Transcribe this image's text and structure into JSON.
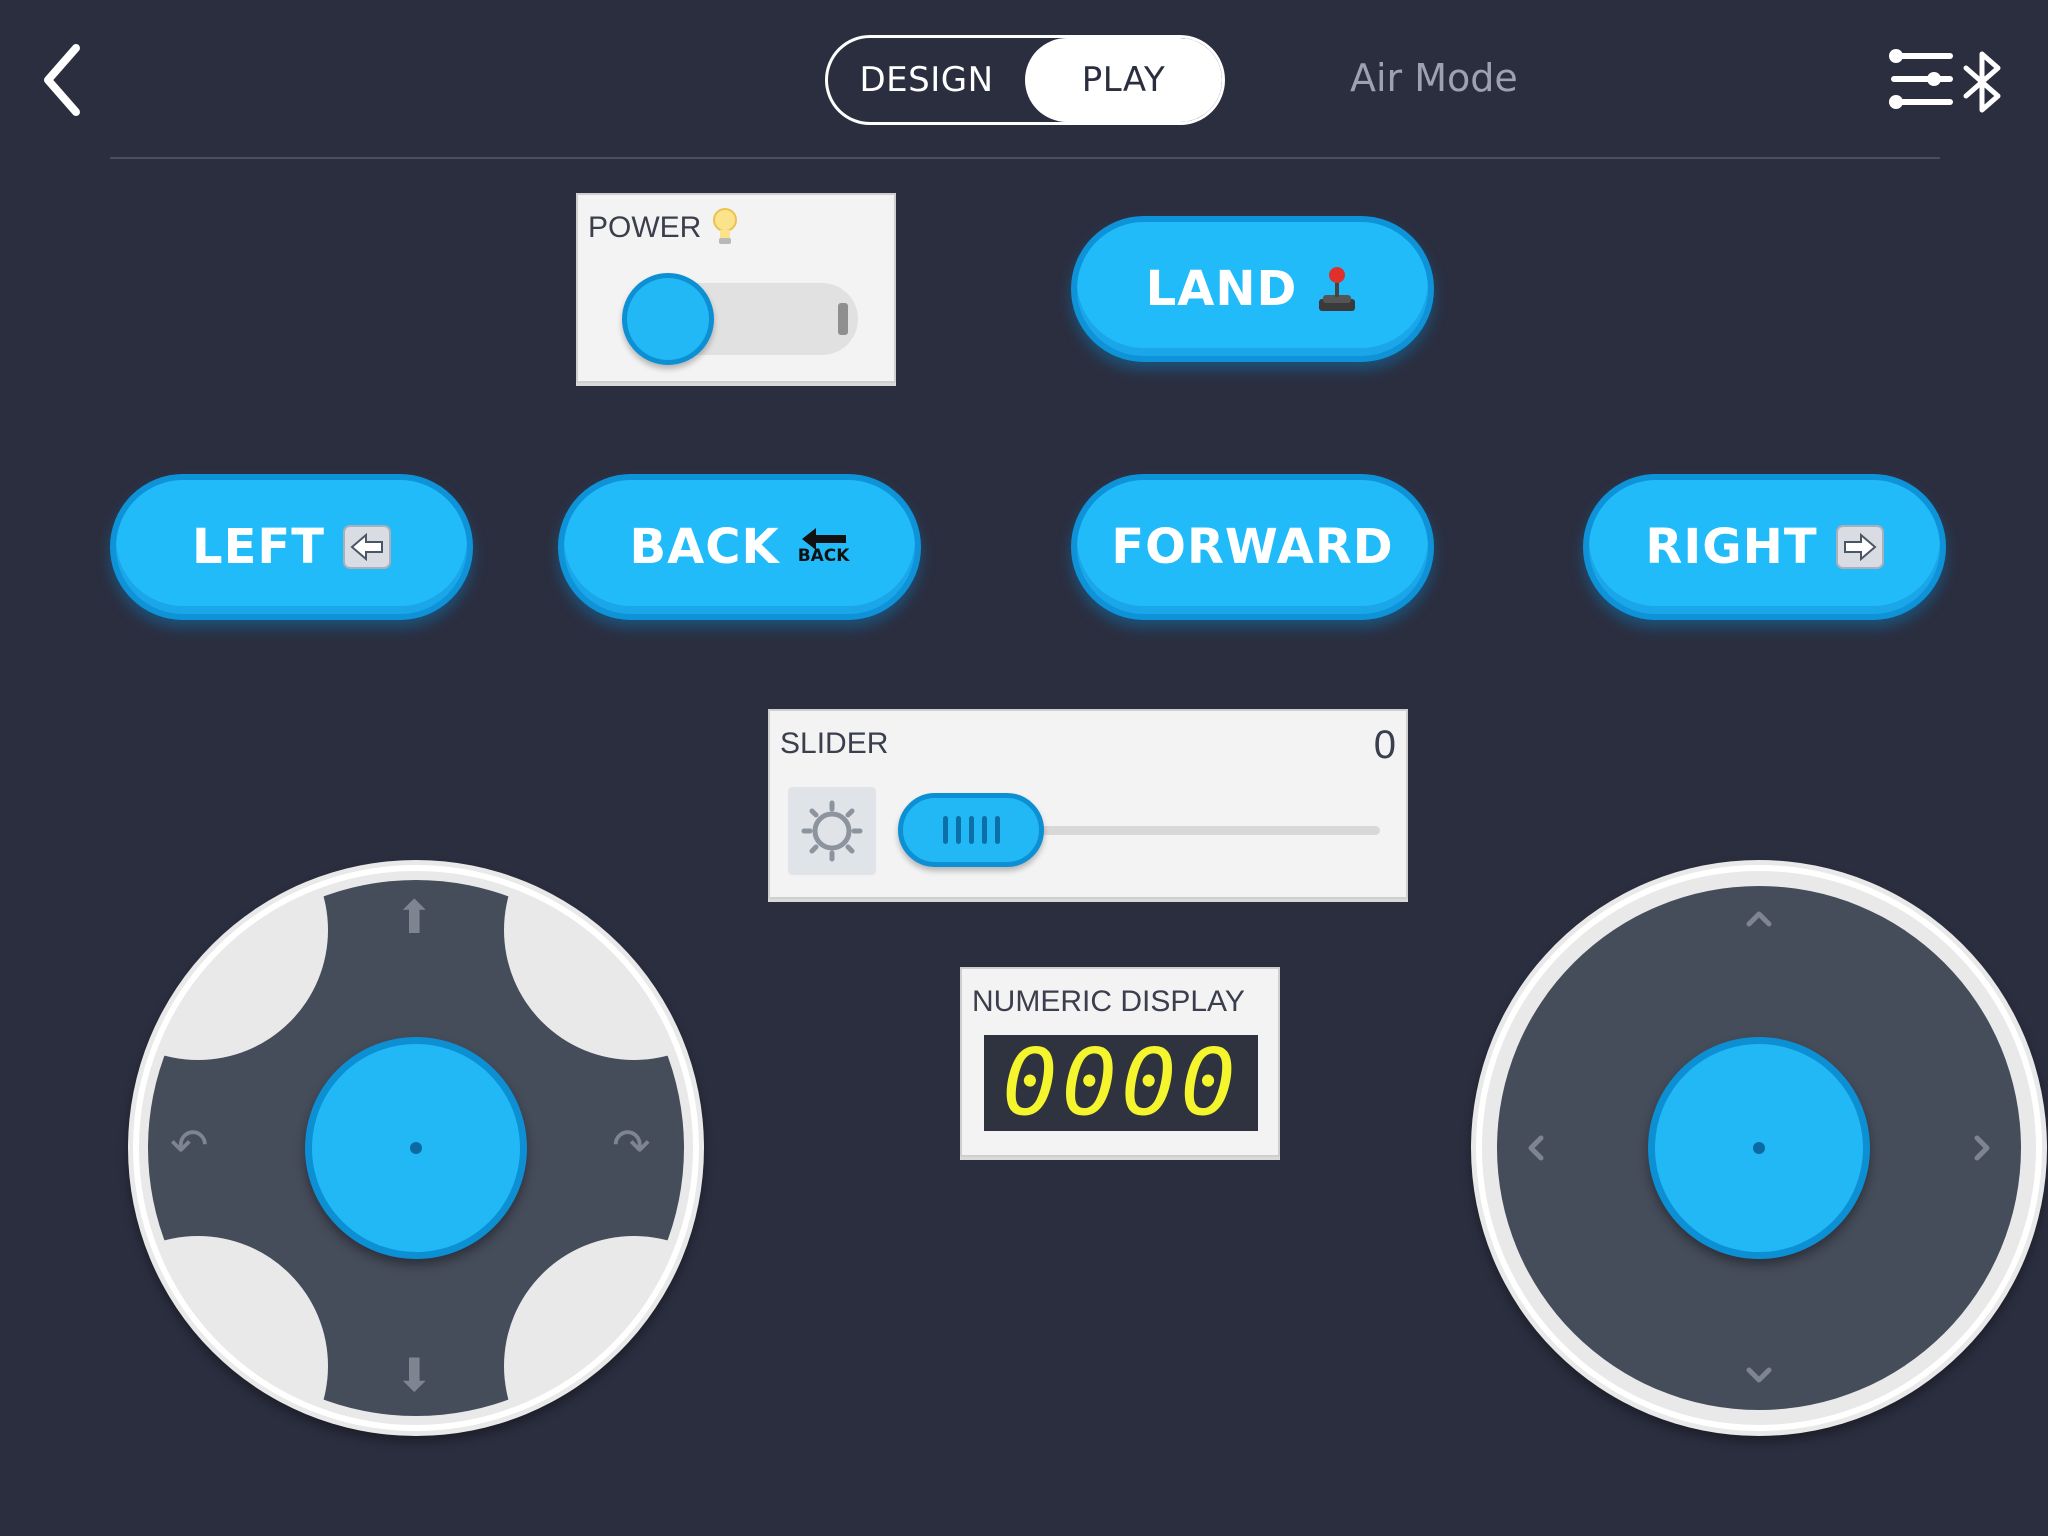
{
  "topbar": {
    "modes": [
      "DESIGN",
      "PLAY"
    ],
    "active_mode": "PLAY",
    "title": "Air Mode",
    "icons": [
      "back-chevron-icon",
      "settings-sliders-icon",
      "bluetooth-icon"
    ]
  },
  "power": {
    "label": "POWER",
    "icon": "lightbulb-icon",
    "state": "off"
  },
  "buttons": {
    "land": {
      "label": "LAND",
      "icon": "joystick-emoji"
    },
    "left": {
      "label": "LEFT",
      "icon": "left-arrow-emoji"
    },
    "back": {
      "label": "BACK",
      "icon": "back-arrow-emoji",
      "icon_text": "BACK"
    },
    "forward": {
      "label": "FORWARD"
    },
    "right": {
      "label": "RIGHT",
      "icon": "right-arrow-emoji"
    }
  },
  "slider": {
    "label": "SLIDER",
    "value": "0",
    "icon": "brightness-icon",
    "accent": "#22b7f5"
  },
  "numeric_display": {
    "label": "NUMERIC DISPLAY",
    "value": "0000",
    "digit_color": "#f5f52d"
  },
  "joysticks": {
    "left": {
      "arrows": [
        "up-arrow-icon",
        "down-arrow-icon",
        "rotate-left-icon",
        "rotate-right-icon"
      ]
    },
    "right": {
      "arrows": [
        "up-chevron-icon",
        "down-chevron-icon",
        "left-chevron-icon",
        "right-chevron-icon"
      ]
    }
  },
  "colors": {
    "background": "#2b2e3f",
    "accent": "#22bbfa",
    "accent_dark": "#0f93d8"
  }
}
